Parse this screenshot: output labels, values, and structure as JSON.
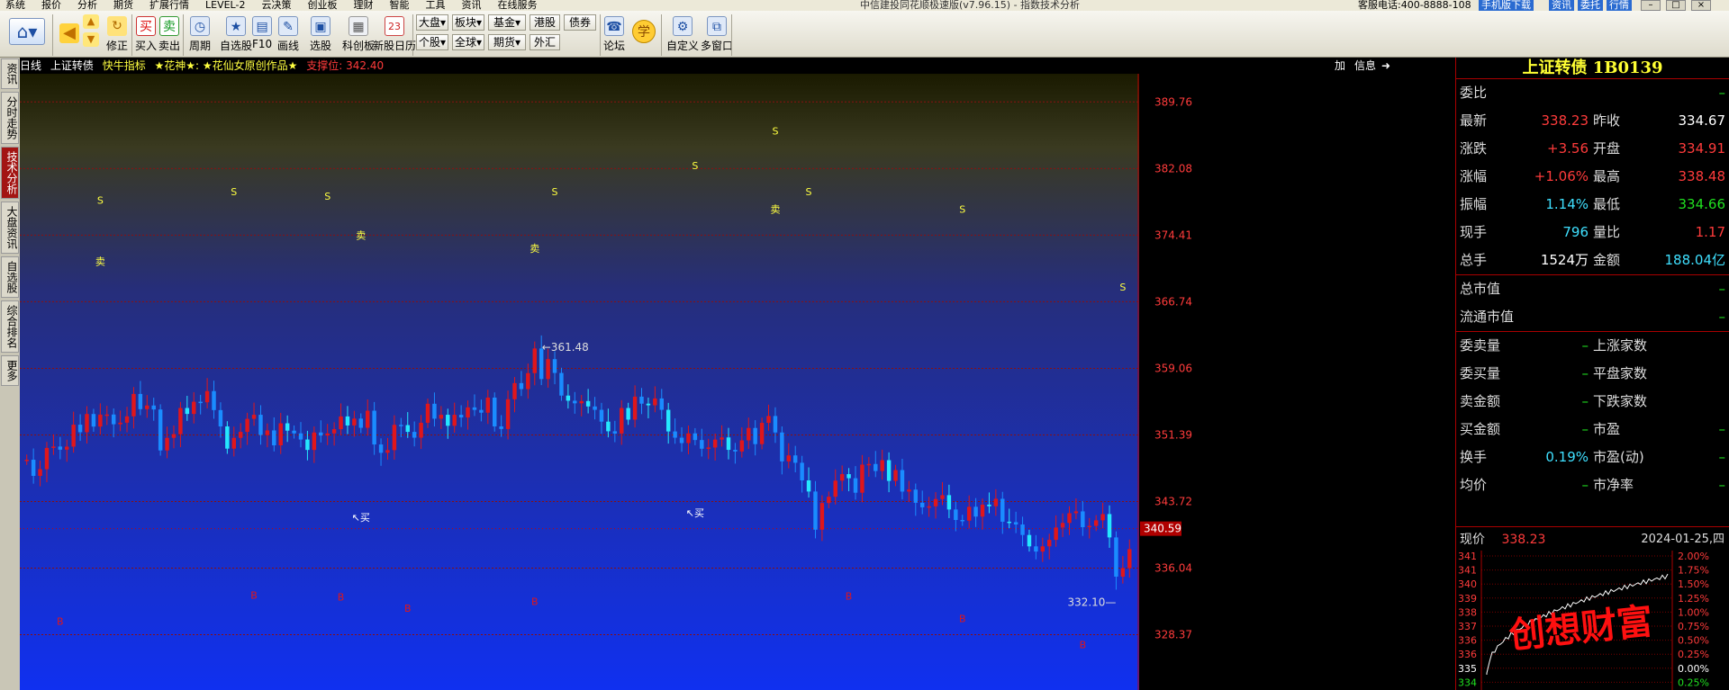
{
  "menu": {
    "items": [
      "系统",
      "报价",
      "分析",
      "期货",
      "扩展行情",
      "LEVEL-2",
      "云决策",
      "创业板",
      "理财",
      "智能",
      "工具",
      "资讯",
      "在线服务"
    ],
    "window_title": "中信建投同花顺极速版(v7.96.15) - 指数技术分析",
    "hotline": "客服电话:400-8888-108",
    "top_buttons": [
      "手机版下载",
      "资讯",
      "委托",
      "行情"
    ]
  },
  "toolbar": {
    "buttons": [
      {
        "label": "修正",
        "icon": "refresh-icon"
      },
      {
        "label": "买入",
        "icon": "buy-icon"
      },
      {
        "label": "卖出",
        "icon": "sell-icon"
      },
      {
        "label": "周期",
        "icon": "clock-icon"
      },
      {
        "label": "自选股",
        "icon": "star-icon"
      },
      {
        "label": "F10",
        "icon": "document-icon"
      },
      {
        "label": "画线",
        "icon": "pen-icon"
      },
      {
        "label": "选股",
        "icon": "screen-icon"
      },
      {
        "label": "科创板",
        "icon": "board-icon"
      },
      {
        "label": "新股日历",
        "icon": "calendar-icon"
      },
      {
        "label": "论坛",
        "icon": "forum-icon"
      },
      {
        "label": "学",
        "icon": "learn-icon"
      },
      {
        "label": "自定义",
        "icon": "custom-icon"
      },
      {
        "label": "多窗口",
        "icon": "multiwindow-icon"
      }
    ],
    "small": {
      "dapan": "大盘",
      "bankuai": "板块",
      "jijin": "基金",
      "ganggu": "港股",
      "zhaiquan": "债券",
      "gegu": "个股",
      "quanqiu": "全球",
      "qihuo": "期货",
      "waihui": "外汇"
    }
  },
  "left_tabs": [
    {
      "label": "资讯",
      "active": false
    },
    {
      "label": "分时走势",
      "active": false
    },
    {
      "label": "技术分析",
      "active": true
    },
    {
      "label": "大盘资讯",
      "active": false
    },
    {
      "label": "自选股",
      "active": false
    },
    {
      "label": "综合排名",
      "active": false
    },
    {
      "label": "更多",
      "active": false
    }
  ],
  "chart_header": {
    "period": "日线",
    "name": "上证转债",
    "indicator": "快牛指标",
    "formula": "★花神★: ★花仙女原创作品★",
    "support": "支撑位: 342.40",
    "right_buttons": [
      "加",
      "信息"
    ]
  },
  "chart_data": {
    "type": "candlestick",
    "y_ticks": [
      389.76,
      382.08,
      374.41,
      366.74,
      359.06,
      351.39,
      343.72,
      336.04,
      328.37
    ],
    "ylim": [
      322.0,
      393.0
    ],
    "current_price_tag": 340.59,
    "high_label": "361.48",
    "low_label": "332.10",
    "signal_labels": {
      "sell_s": "S",
      "sell_word": "卖",
      "buy_b": "B",
      "buy_word": "↖买"
    },
    "candles": [
      348.53,
      346.67,
      347.44,
      349.89,
      350.05,
      349.69,
      350.04,
      352.57,
      351.7,
      353.8,
      352.35,
      353.73,
      353.74,
      352.62,
      352.8,
      353.53,
      356.11,
      354.36,
      354.78,
      354.32,
      349.6,
      351.05,
      351.48,
      354.49,
      353.81,
      355.21,
      355.15,
      356.44,
      354.25,
      352.37,
      349.81,
      351.05,
      351.74,
      353.24,
      353.71,
      351.37,
      351.91,
      350.19,
      352.73,
      351.88,
      351.57,
      350.86,
      349.66,
      351.67,
      351.32,
      351.56,
      352.05,
      353.52,
      352.48,
      353.27,
      352.21,
      354.18,
      350.29,
      349.33,
      349.64,
      352.55,
      352.52,
      351.74,
      351.07,
      352.79,
      354.98,
      353.26,
      353.71,
      352.44,
      353.71,
      353.4,
      354.56,
      354.27,
      353.95,
      355.69,
      352.37,
      352.07,
      355.5,
      357.36,
      356.67,
      358.51,
      361.35,
      357.83,
      360.12,
      358.53,
      355.92,
      355.33,
      355.03,
      355.29,
      354.67,
      354.28,
      352.92,
      351.81,
      351.55,
      354.49,
      353.15,
      355.8,
      354.99,
      354.8,
      355.59,
      354.28,
      351.79,
      351.07,
      350.45,
      351.57,
      350.8,
      349.8,
      349.94,
      350.85,
      351.1,
      349.67,
      349.48,
      350.76,
      352.19,
      350.33,
      352.78,
      353.57,
      351.67,
      348.34,
      349.03,
      348.18,
      346.15,
      344.87,
      340.47,
      343.54,
      344.27,
      346.12,
      346.87,
      346.4,
      344.73,
      347.97,
      348.04,
      347.23,
      348.48,
      346.09,
      347.34,
      344.86,
      345.09,
      343.57,
      343.05,
      343.16,
      344.0,
      344.45,
      342.8,
      341.59,
      341.51,
      343.11,
      341.98,
      343.36,
      343.17,
      344.03,
      341.39,
      341.34,
      341.07,
      339.86,
      338.55,
      337.95,
      338.55,
      339.3,
      340.72,
      341.25,
      342.37,
      342.58,
      340.76,
      340.91,
      341.55,
      342.27,
      339.58,
      335.06,
      336.04,
      338.23
    ]
  },
  "quote": {
    "title": "上证转债 1B0139",
    "rows": [
      {
        "l1": "委比",
        "v1": "",
        "l2": "",
        "v2": "–"
      },
      {
        "l1": "最新",
        "v1": "338.23",
        "l2": "昨收",
        "v2": "334.67"
      },
      {
        "l1": "涨跌",
        "v1": "+3.56",
        "l2": "开盘",
        "v2": "334.91"
      },
      {
        "l1": "涨幅",
        "v1": "+1.06%",
        "l2": "最高",
        "v2": "338.48"
      },
      {
        "l1": "振幅",
        "v1": "1.14%",
        "l2": "最低",
        "v2": "334.66"
      },
      {
        "l1": "现手",
        "v1": "796",
        "l2": "量比",
        "v2": "1.17"
      },
      {
        "l1": "总手",
        "v1": "1524万",
        "l2": "金额",
        "v2": "188.04亿"
      },
      {
        "l1": "总市值",
        "v1": "",
        "l2": "",
        "v2": "–"
      },
      {
        "l1": "流通市值",
        "v1": "",
        "l2": "",
        "v2": "–"
      },
      {
        "l1": "委卖量",
        "v1": "–",
        "l2": "上涨家数",
        "v2": ""
      },
      {
        "l1": "委买量",
        "v1": "–",
        "l2": "平盘家数",
        "v2": ""
      },
      {
        "l1": "卖金额",
        "v1": "–",
        "l2": "下跌家数",
        "v2": ""
      },
      {
        "l1": "买金额",
        "v1": "–",
        "l2": "市盈",
        "v2": "–"
      },
      {
        "l1": "换手",
        "v1": "0.19%",
        "l2": "市盈(动)",
        "v2": "–"
      },
      {
        "l1": "均价",
        "v1": "–",
        "l2": "市净率",
        "v2": "–"
      }
    ],
    "mini": {
      "label": "现价",
      "price": "338.23",
      "date": "2024-01-25,四",
      "left_ticks": [
        "341",
        "341",
        "340",
        "339",
        "338",
        "337",
        "336",
        "336",
        "335",
        "334"
      ],
      "right_ticks": [
        "2.00%",
        "1.75%",
        "1.50%",
        "1.25%",
        "1.00%",
        "0.75%",
        "0.50%",
        "0.25%",
        "0.00%",
        "0.25%"
      ],
      "watermark": "创想财富"
    }
  }
}
